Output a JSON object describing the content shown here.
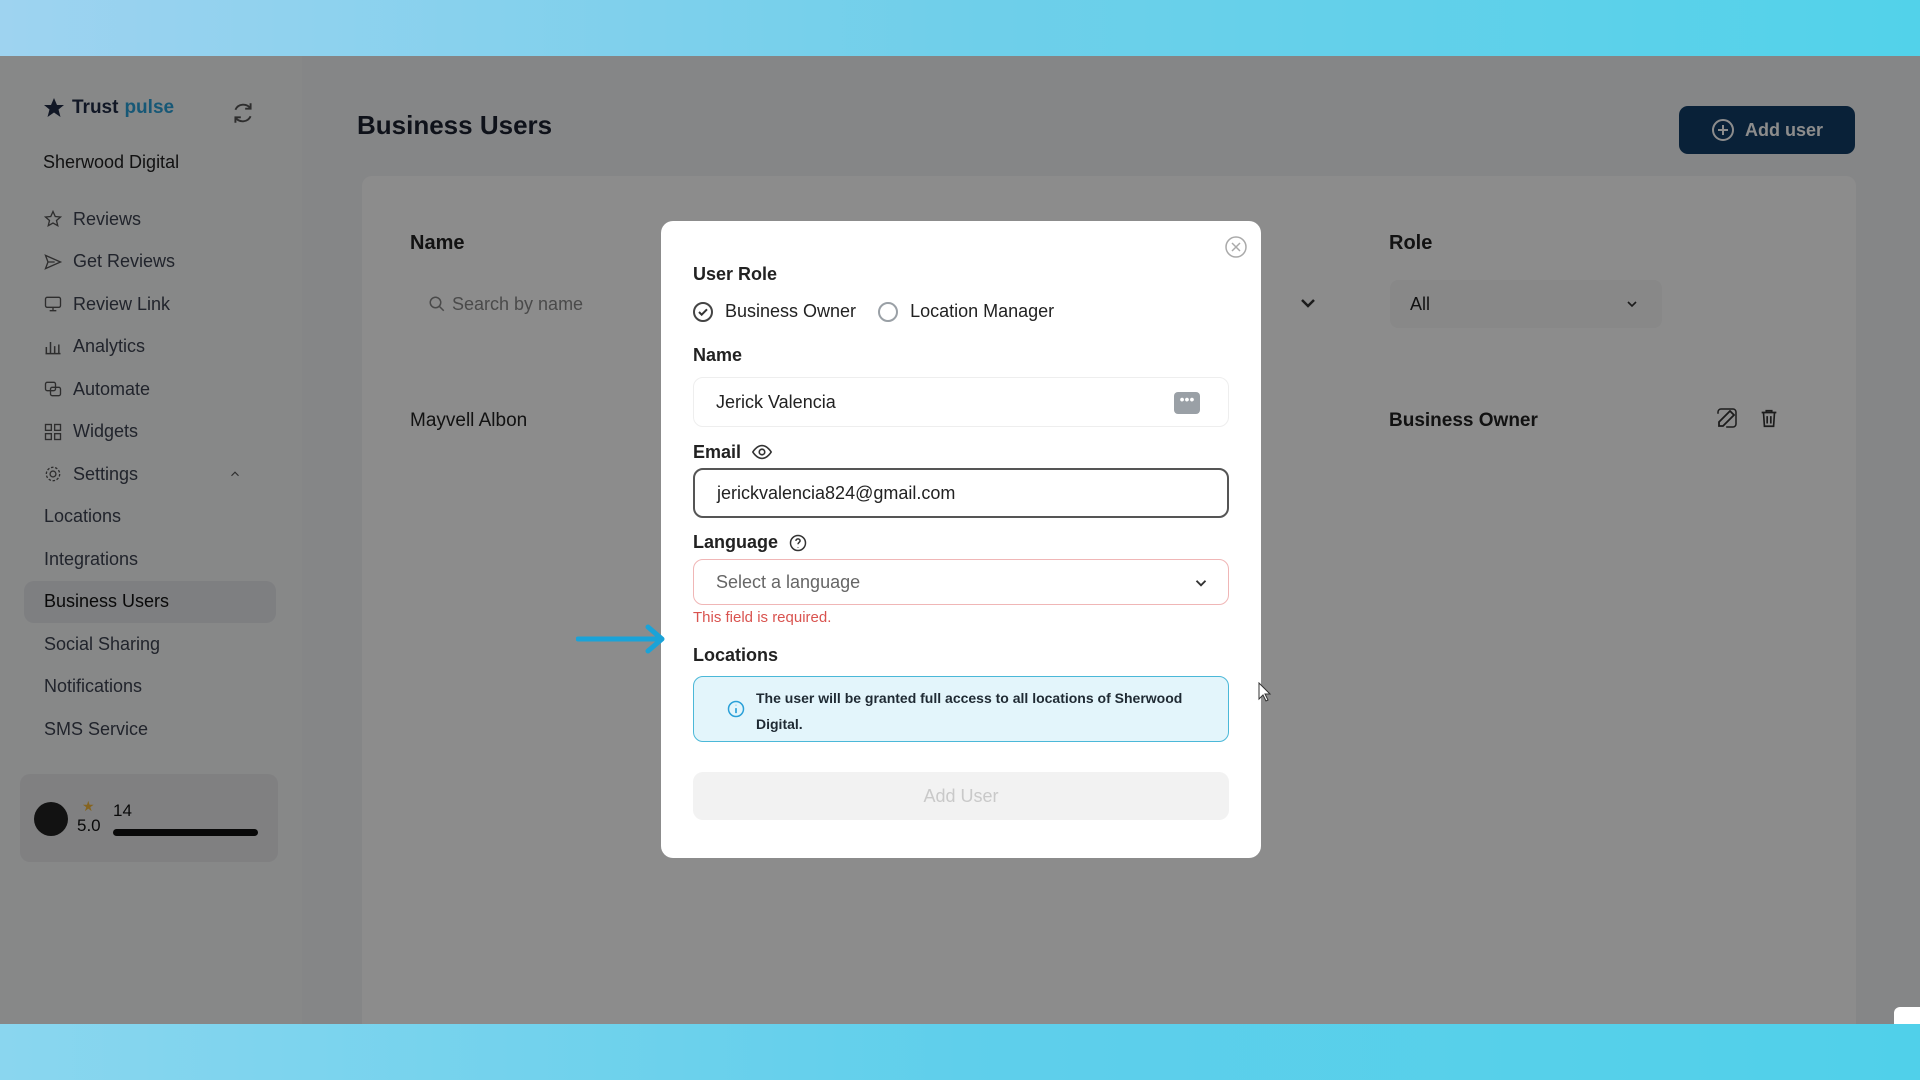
{
  "sidebar": {
    "logo": {
      "word1": "Trust",
      "word2": "pulse"
    },
    "company": "Sherwood Digital",
    "items": [
      {
        "label": "Reviews",
        "icon": "star-icon"
      },
      {
        "label": "Get Reviews",
        "icon": "send-icon"
      },
      {
        "label": "Review Link",
        "icon": "monitor-icon"
      },
      {
        "label": "Analytics",
        "icon": "bar-chart-icon"
      },
      {
        "label": "Automate",
        "icon": "automate-icon"
      },
      {
        "label": "Widgets",
        "icon": "widgets-icon"
      },
      {
        "label": "Settings",
        "icon": "gear-icon"
      }
    ],
    "sub_items": [
      "Locations",
      "Integrations",
      "Business Users",
      "Social Sharing",
      "Notifications",
      "SMS Service"
    ],
    "active_item": "Business Users",
    "rating": {
      "value": "5.0",
      "count": "14"
    }
  },
  "header": {
    "title": "Business Users",
    "add_user": "Add user"
  },
  "table": {
    "col_name": "Name",
    "col_role": "Role",
    "search_placeholder": "Search by name",
    "role_filter": "All",
    "rows": [
      {
        "name": "Mayvell Albon",
        "role": "Business Owner"
      }
    ]
  },
  "modal": {
    "user_role_label": "User Role",
    "role_options": [
      "Business Owner",
      "Location Manager"
    ],
    "selected_role": "Business Owner",
    "name_label": "Name",
    "name_value": "Jerick Valencia",
    "email_label": "Email",
    "email_value": "jerickvalencia824@gmail.com",
    "language_label": "Language",
    "language_placeholder": "Select a language",
    "language_error": "This field is required.",
    "locations_label": "Locations",
    "locations_info": "The user will be granted full access to all locations of Sherwood Digital.",
    "submit": "Add User"
  },
  "colors": {
    "primary": "#123d66",
    "accent": "#2aa0d8",
    "error": "#d9534f",
    "info_border": "#4bb8d8",
    "annotation_arrow": "#1aa3d8"
  }
}
